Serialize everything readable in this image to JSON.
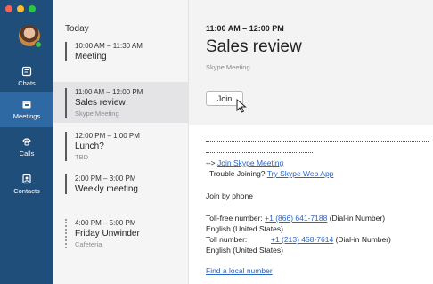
{
  "nav": {
    "items": [
      {
        "label": "Chats",
        "icon": "chat-icon"
      },
      {
        "label": "Meetings",
        "icon": "calendar-icon"
      },
      {
        "label": "Calls",
        "icon": "phone-icon"
      },
      {
        "label": "Contacts",
        "icon": "contacts-icon"
      }
    ],
    "active": "Meetings"
  },
  "list": {
    "heading": "Today",
    "events": [
      {
        "time": "10:00 AM – 11:30 AM",
        "title": "Meeting",
        "sub": ""
      },
      {
        "time": "11:00 AM – 12:00 PM",
        "title": "Sales review",
        "sub": "Skype Meeting"
      },
      {
        "time": "12:00 PM – 1:00 PM",
        "title": "Lunch?",
        "sub": "TBD"
      },
      {
        "time": "2:00 PM – 3:00 PM",
        "title": "Weekly meeting",
        "sub": ""
      },
      {
        "time": "4:00 PM – 5:00 PM",
        "title": "Friday Unwinder",
        "sub": "Cafeteria"
      }
    ]
  },
  "detail": {
    "time": "11:00 AM – 12:00 PM",
    "title": "Sales review",
    "sub": "Skype Meeting",
    "join_label": "Join",
    "join_skype_prefix": "--> ",
    "join_skype_link": "Join Skype Meeting",
    "trouble_prefix": "Trouble Joining? ",
    "trouble_link": "Try Skype Web App",
    "join_by_phone": "Join by phone",
    "tollfree_label": "Toll-free number: ",
    "tollfree_number": "+1 (866) 641-7188",
    "tollfree_suffix": " (Dial-in Number)",
    "tollfree_region": "English (United States)",
    "toll_label": "Toll number:",
    "toll_number": "+1 (213) 458-7614",
    "toll_suffix": " (Dial-in Number)",
    "toll_region": "English (United States)",
    "local_link": "Find a local number"
  },
  "colors": {
    "rail": "#1f4e7a",
    "rail_active": "#2f69a3",
    "link": "#2a64c4"
  }
}
